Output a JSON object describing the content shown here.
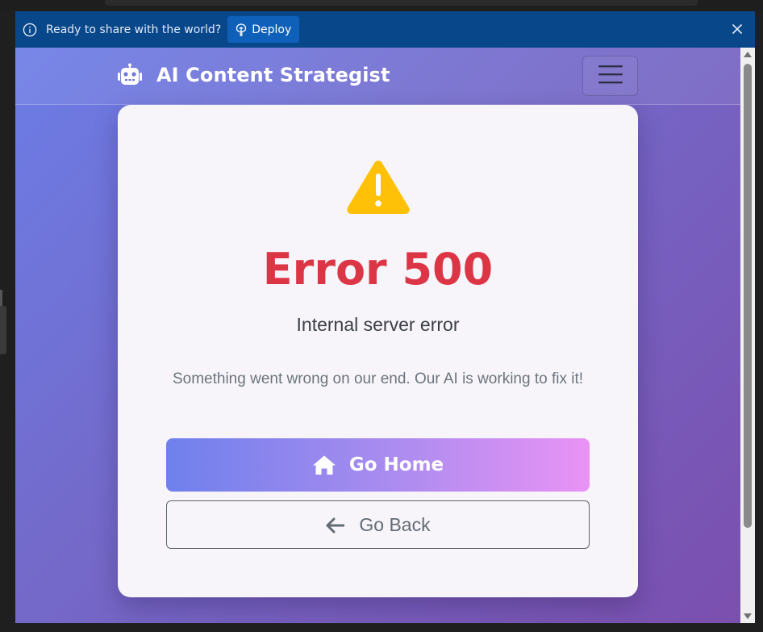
{
  "banner": {
    "message": "Ready to share with the world?",
    "deploy_label": "Deploy",
    "background": "#08478a"
  },
  "navbar": {
    "brand_title": "AI Content Strategist",
    "brand_icon": "robot-icon",
    "toggler_icon": "hamburger-menu-icon"
  },
  "error": {
    "icon": "warning-triangle-icon",
    "title": "Error 500",
    "subtitle": "Internal server error",
    "description": "Something went wrong on our end. Our AI is working to fix it!",
    "title_color": "#dc3545"
  },
  "actions": {
    "home_label": "Go Home",
    "home_icon": "home-icon",
    "back_label": "Go Back",
    "back_icon": "arrow-left-icon"
  },
  "colors": {
    "background_gradient_start": "#6c7de6",
    "background_gradient_end": "#7b4fae",
    "home_gradient_start": "#6f80ec",
    "home_gradient_end": "#e993f5",
    "warning": "#ffc107"
  }
}
